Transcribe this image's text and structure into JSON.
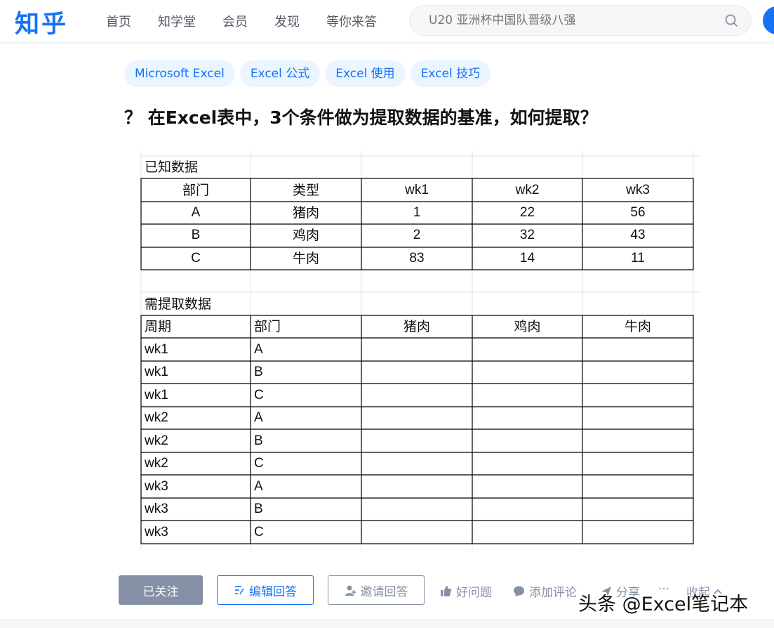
{
  "header": {
    "logo": "知乎",
    "nav": [
      "首页",
      "知学堂",
      "会员",
      "发现",
      "等你来答"
    ],
    "search_placeholder": "U20 亚洲杯中国队晋级八强",
    "accent": "#1772f6"
  },
  "topics": [
    "Microsoft Excel",
    "Excel 公式",
    "Excel 使用",
    "Excel 技巧"
  ],
  "question": {
    "title": "？ 在Excel表中，3个条件做为提取数据的基准，如何提取？"
  },
  "sheet": {
    "known_title": "已知数据",
    "known_headers": [
      "部门",
      "类型",
      "wk1",
      "wk2",
      "wk3"
    ],
    "known_rows": [
      [
        "A",
        "猪肉",
        "1",
        "22",
        "56"
      ],
      [
        "B",
        "鸡肉",
        "2",
        "32",
        "43"
      ],
      [
        "C",
        "牛肉",
        "83",
        "14",
        "11"
      ]
    ],
    "extract_title": "需提取数据",
    "extract_headers": [
      "周期",
      "部门",
      "猪肉",
      "鸡肉",
      "牛肉"
    ],
    "extract_rows": [
      [
        "wk1",
        "A"
      ],
      [
        "wk1",
        "B"
      ],
      [
        "wk1",
        "C"
      ],
      [
        "wk2",
        "A"
      ],
      [
        "wk2",
        "B"
      ],
      [
        "wk2",
        "C"
      ],
      [
        "wk3",
        "A"
      ],
      [
        "wk3",
        "B"
      ],
      [
        "wk3",
        "C"
      ]
    ]
  },
  "actions": {
    "followed": "已关注",
    "write_answer": "编辑回答",
    "invite": "邀请回答",
    "good_question": "好问题",
    "comment": "添加评论",
    "share": "分享",
    "more": "···",
    "collapse": "收起"
  },
  "watermark": "头条 @Excel笔记本"
}
